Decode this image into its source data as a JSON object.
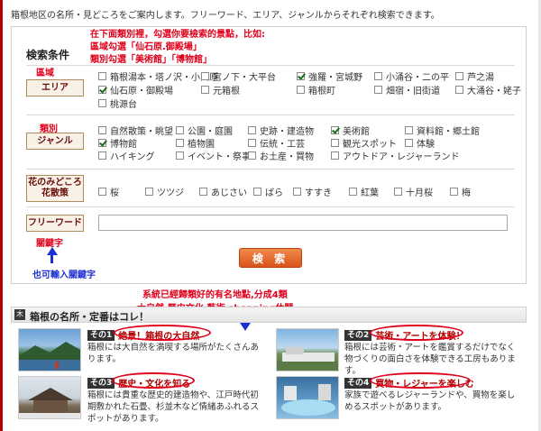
{
  "intro": "箱根地区の名所・見どころをご案内します。フリーワード、エリア、ジャンルからそれぞれ検索できます。",
  "search": {
    "title": "検索条件",
    "button": "検 索",
    "free_value": ""
  },
  "categories": {
    "area": "エリア",
    "genre": "ジャンル",
    "flower_line1": "花のみどころ",
    "flower_line2": "花散策",
    "freeword": "フリーワード"
  },
  "area_options": [
    {
      "label": "箱根湯本・塔ノ沢・小田原",
      "checked": false
    },
    {
      "label": "宮ノ下・大平台",
      "checked": false
    },
    {
      "label": "強羅・宮城野",
      "checked": true
    },
    {
      "label": "小涌谷・二の平",
      "checked": false
    },
    {
      "label": "芦之湯",
      "checked": false
    },
    {
      "label": "仙石原・御殿場",
      "checked": true
    },
    {
      "label": "元箱根",
      "checked": false
    },
    {
      "label": "箱根町",
      "checked": false
    },
    {
      "label": "畑宿・旧街道",
      "checked": false
    },
    {
      "label": "大涌谷・姥子",
      "checked": false
    },
    {
      "label": "桃源台",
      "checked": false
    }
  ],
  "genre_options": [
    {
      "label": "自然散策・眺望",
      "checked": false
    },
    {
      "label": "公園・庭園",
      "checked": false
    },
    {
      "label": "史跡・建造物",
      "checked": false
    },
    {
      "label": "美術館",
      "checked": true
    },
    {
      "label": "資料館・郷土館",
      "checked": false
    },
    {
      "label": "博物館",
      "checked": true
    },
    {
      "label": "植物園",
      "checked": false
    },
    {
      "label": "伝統・工芸",
      "checked": false
    },
    {
      "label": "観光スポット",
      "checked": false
    },
    {
      "label": "体験",
      "checked": false
    },
    {
      "label": "ハイキング",
      "checked": false
    },
    {
      "label": "イベント・祭事",
      "checked": false
    },
    {
      "label": "お土産・買物",
      "checked": false
    },
    {
      "label": "アウトドア・レジャーランド",
      "checked": false
    }
  ],
  "flower_options": [
    {
      "label": "桜",
      "checked": false
    },
    {
      "label": "ツツジ",
      "checked": false
    },
    {
      "label": "あじさい",
      "checked": false
    },
    {
      "label": "ばら",
      "checked": false
    },
    {
      "label": "すすき",
      "checked": false
    },
    {
      "label": "紅葉",
      "checked": false
    },
    {
      "label": "十月桜",
      "checked": false
    },
    {
      "label": "梅",
      "checked": false
    }
  ],
  "annotations": {
    "top_line1": "在下面類別裡，勾選你要檢索的景點，比如:",
    "top_line2": "區域勾選「仙石原.御殿場」",
    "top_line3": "類別勾選「美術館」「博物館」",
    "area": "區域",
    "genre": "類別",
    "keyword": "關鍵字",
    "keyword_input": "也可輸入關鍵字",
    "spots_line1": "系統已經歸類好的有名地點,分成4類",
    "spots_line2": "大自然.歷史文化.藝術.shopping休閒"
  },
  "spots_header": "箱根の名所・定番はコレ！",
  "spots": [
    {
      "num": "その1",
      "name": "絶景！箱根の大自然",
      "desc": "箱根には大自然を満喫する場所がたくさんあります。"
    },
    {
      "num": "その2",
      "name": "芸術・アートを体験！",
      "desc": "箱根には芸術・アートを鑑賞するだけでなく物づくりの面白さを体験できる工房もあります。"
    },
    {
      "num": "その3",
      "name": "歴史・文化を知る",
      "desc": "箱根には貴重な歴史的建造物や、江戸時代初期敷かれた石畳、杉並木など情緒あふれるスポットがあります。"
    },
    {
      "num": "その4",
      "name": "買物・レジャーを楽しむ",
      "desc": "家族で遊べるレジャーランドや、買物を楽しめるスポットがあります。"
    }
  ],
  "colors": {
    "accent": "#e0001b",
    "annotation_blue": "#1e2fd0",
    "brand_red": "#b00000",
    "button_orange": "#e06a2a"
  }
}
